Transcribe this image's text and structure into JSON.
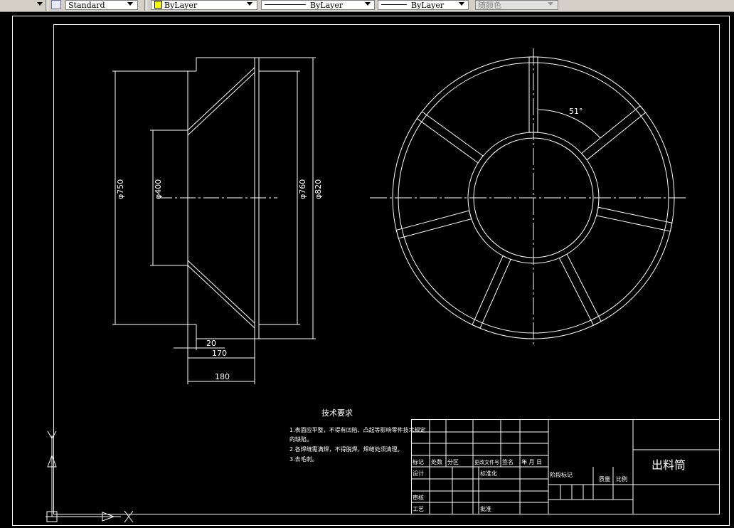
{
  "toolbar": {
    "text_style": "Standard",
    "layer_color": "ByLayer",
    "linetype": "ByLayer",
    "lineweight": "ByLayer",
    "plot_style": "随颜色",
    "layer_color_swatch": "#ffff00"
  },
  "drawing": {
    "dimensions": {
      "d750": "φ750",
      "d400": "φ400",
      "d760": "φ760",
      "d820": "φ820",
      "w20": "20",
      "w170": "170",
      "w180": "180",
      "angle": "51°"
    },
    "tech_req": {
      "title": "技术要求",
      "item1": "1.表面应平整，不得有凹陷、凸起等影响零件技术规定",
      "item1b": "的缺陷。",
      "item2": "2.各焊缝需满焊，不得脱焊，焊缝处须清理。",
      "item3": "3.去毛刺。"
    },
    "title_block": {
      "biaoji": "标记",
      "chushu": "处数",
      "fenqu": "分区",
      "gengai": "更改文件号",
      "qianming": "签名",
      "nianyueri": "年 月 日",
      "sheji": "设计",
      "biaozhunhua": "标准化",
      "jieduan": "阶段标记",
      "zhiliang": "质量",
      "bili": "比例",
      "shenhe": "审核",
      "gongyi": "工艺",
      "pizhun": "批准",
      "part_name": "出料筒"
    }
  },
  "colors": {
    "background": "#000000",
    "lines": "#ffffff",
    "toolbar_bg": "#d4d0c8"
  }
}
